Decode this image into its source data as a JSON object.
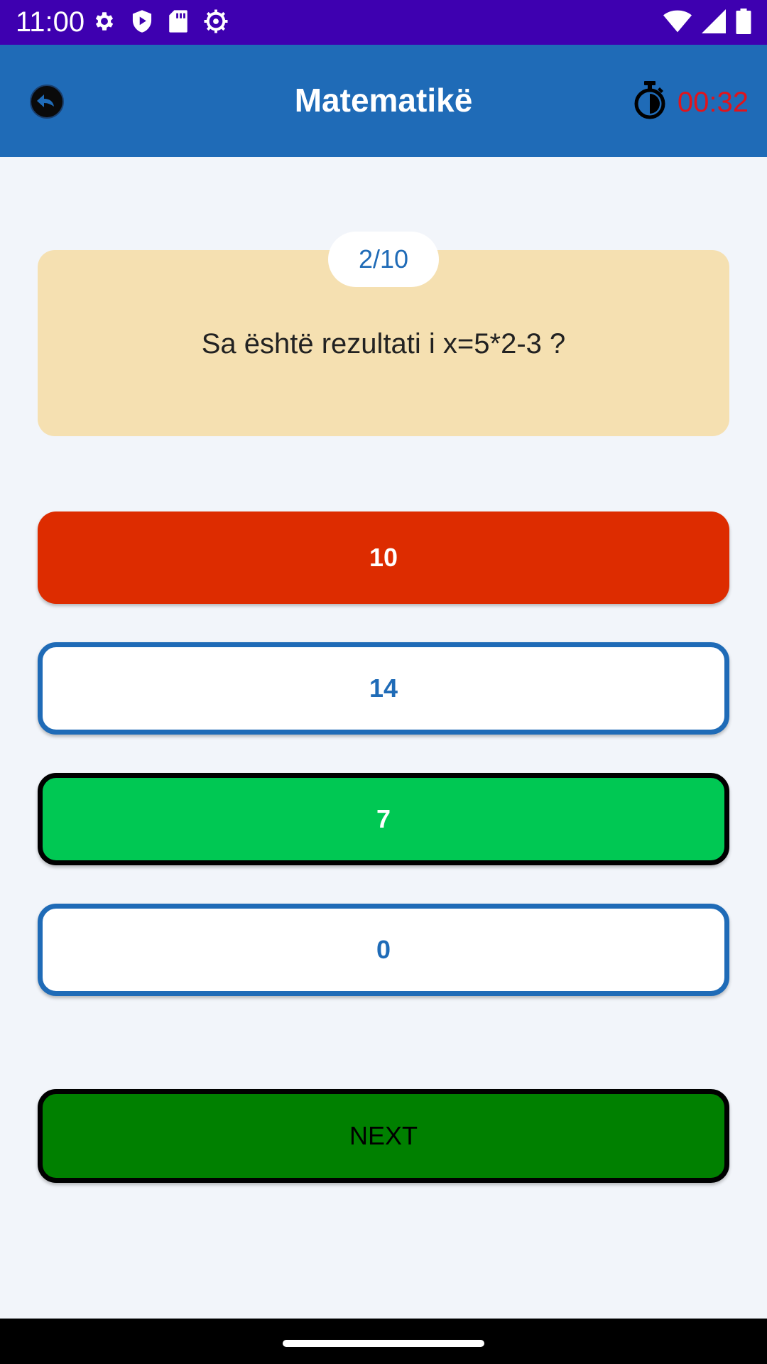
{
  "status_bar": {
    "time": "11:00",
    "icons_left": [
      "settings-gear-icon",
      "play-protect-icon",
      "sd-card-icon",
      "settings-cog-icon"
    ],
    "icons_right": [
      "wifi-icon",
      "signal-icon",
      "battery-icon"
    ],
    "background": "#3e00b0"
  },
  "app_bar": {
    "title": "Matematikë",
    "back_icon": "back-arrow-icon",
    "timer_icon": "stopwatch-icon",
    "timer": "00:32",
    "background": "#1f6bb7",
    "timer_color": "#e0141c"
  },
  "question": {
    "counter": "2/10",
    "text": "Sa është rezultati i x=5*2-3 ?",
    "card_color": "#f5e0b1"
  },
  "answers": [
    {
      "label": "10",
      "state": "wrong",
      "color": "#dd2c00"
    },
    {
      "label": "14",
      "state": "default",
      "color": "#ffffff"
    },
    {
      "label": "7",
      "state": "correct",
      "color": "#00c853"
    },
    {
      "label": "0",
      "state": "default",
      "color": "#ffffff"
    }
  ],
  "next_button": {
    "label": "NEXT",
    "color": "#008000"
  }
}
